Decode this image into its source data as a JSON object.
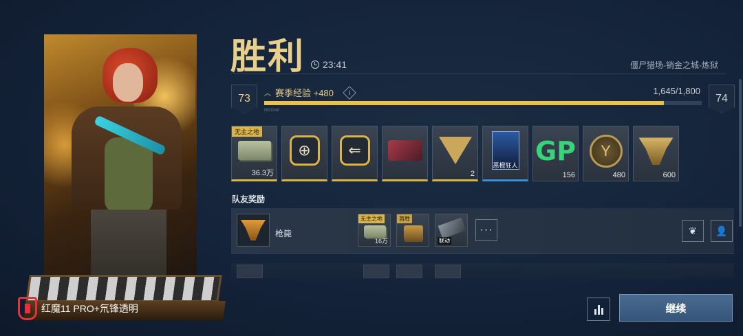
{
  "brand": {
    "text": "红魔11 PRO+氘锋透明"
  },
  "header": {
    "result_title": "胜利",
    "match_time": "23:41",
    "map_name": "僵尸猎场-销金之城-炼狱"
  },
  "progress": {
    "current_level": "73",
    "next_level": "74",
    "label": "赛季经验 +480",
    "info_glyph": "i",
    "xp_text": "1,645/1,800",
    "xp_fraction": 0.914,
    "tiny_text": "NE2048"
  },
  "rewards": [
    {
      "icon": "cash-bundle-icon",
      "tag": "无主之地",
      "qty": "36.3万"
    },
    {
      "icon": "hex-emblem-icon",
      "tag": "",
      "qty": ""
    },
    {
      "icon": "arrow-emblem-icon",
      "tag": "",
      "qty": ""
    },
    {
      "icon": "weapon-skin-icon",
      "tag": "",
      "qty": ""
    },
    {
      "icon": "triangle-emblem-icon",
      "tag": "",
      "qty": "2"
    },
    {
      "icon": "character-card-icon",
      "tag": "",
      "qty": "",
      "name": "恶棍狂人"
    },
    {
      "icon": "gp-currency-icon",
      "tag": "",
      "qty": "156"
    },
    {
      "icon": "coin-emblem-icon",
      "tag": "",
      "qty": "480"
    },
    {
      "icon": "wing-emblem-icon",
      "tag": "",
      "qty": "600"
    }
  ],
  "gp_text": "GP",
  "coin_glyph": "Y",
  "hex_glyph": "⊕",
  "arrow_glyph": "⇐",
  "team": {
    "section_title": "队友奖励",
    "members": [
      {
        "name": "枪毙",
        "items": [
          {
            "tag": "无主之地",
            "qty": "16万"
          },
          {
            "tag": "首胜",
            "qty": ""
          },
          {
            "label": "联动",
            "qty": ""
          }
        ],
        "more_label": "···"
      }
    ]
  },
  "footer": {
    "continue_label": "继续"
  },
  "colors": {
    "accent_gold": "#e8cf8a",
    "xp_bar": "#e8c24a",
    "brand_red": "#e8313b",
    "gp_green": "#39d37a"
  }
}
